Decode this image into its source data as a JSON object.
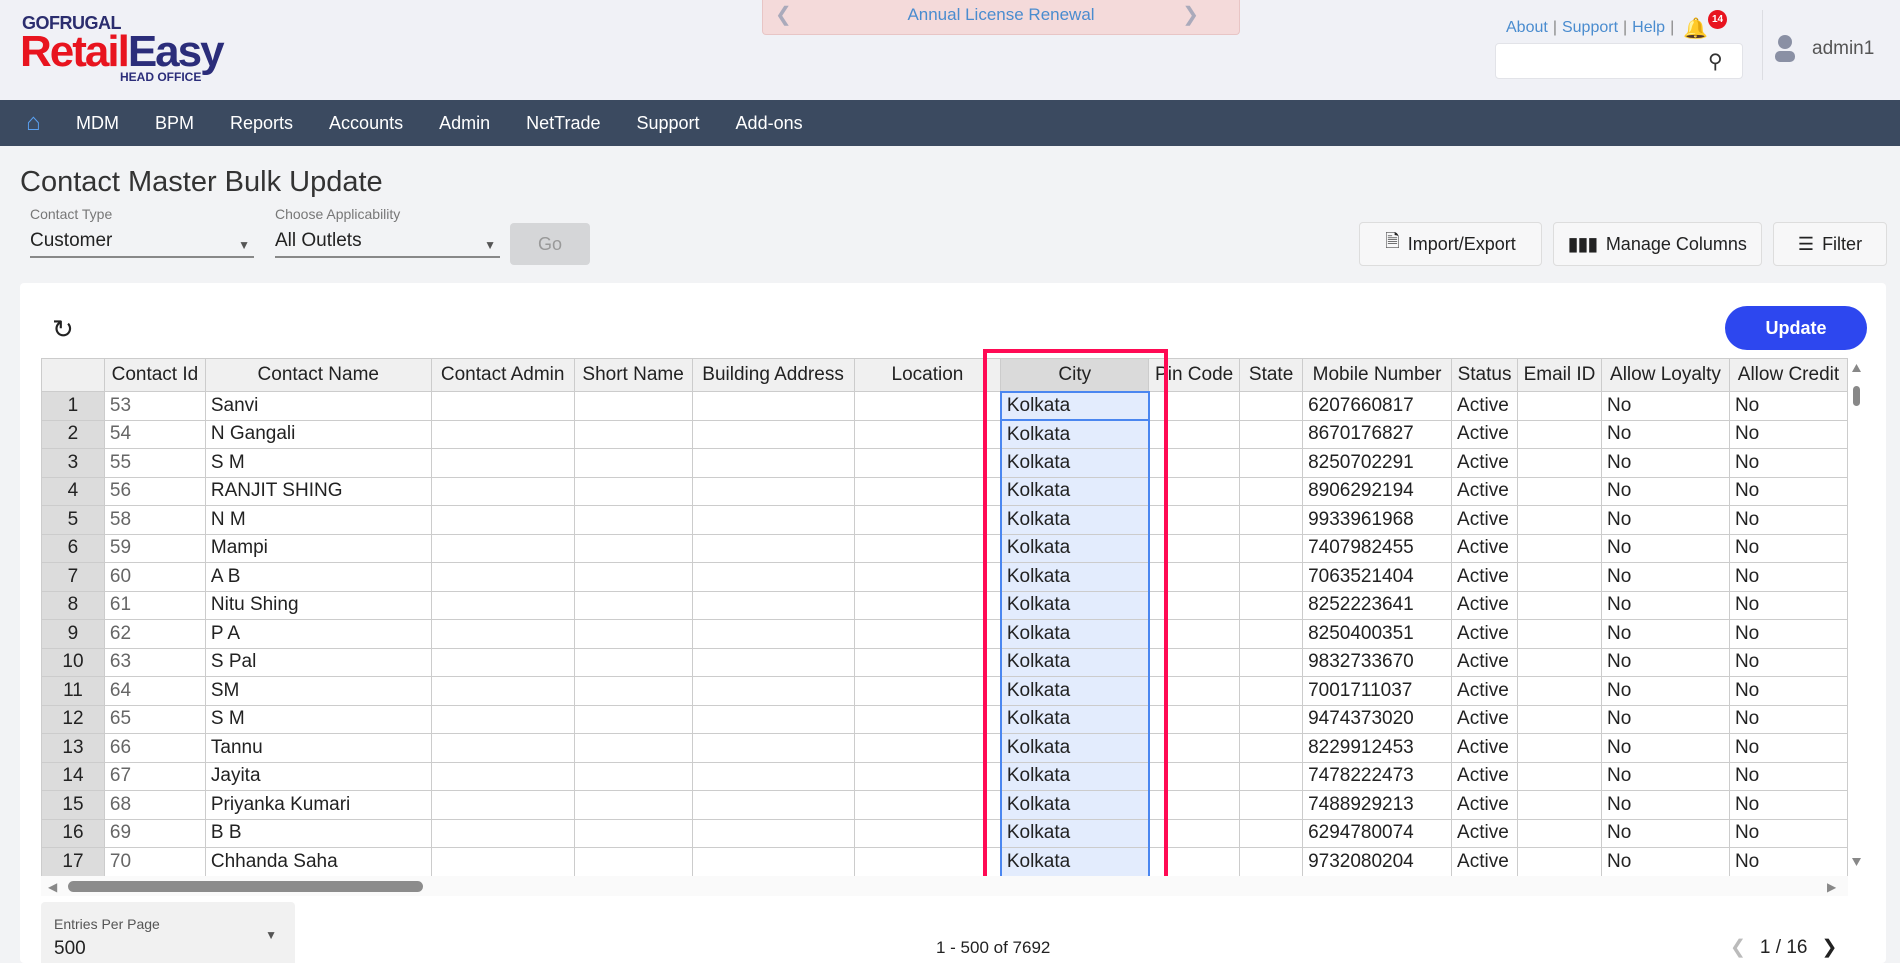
{
  "brand": {
    "top": "GOFRUGAL",
    "main_red": "Retail",
    "main_blue": "Easy",
    "sub": "HEAD OFFICE"
  },
  "banner": {
    "text": "Annual License Renewal"
  },
  "toplinks": {
    "about": "About",
    "support": "Support",
    "help": "Help",
    "notifications": "14"
  },
  "search": {
    "placeholder": "",
    "value": ""
  },
  "user": {
    "name": "admin1"
  },
  "nav": {
    "items": [
      "MDM",
      "BPM",
      "Reports",
      "Accounts",
      "Admin",
      "NetTrade",
      "Support",
      "Add-ons"
    ]
  },
  "page": {
    "title": "Contact Master Bulk Update"
  },
  "filters": {
    "contact_type_label": "Contact Type",
    "contact_type_value": "Customer",
    "applicability_label": "Choose Applicability",
    "applicability_value": "All Outlets",
    "go": "Go"
  },
  "toolbar": {
    "import_export": "Import/Export",
    "manage_columns": "Manage Columns",
    "filter": "Filter",
    "update": "Update"
  },
  "grid": {
    "columns": [
      "Contact Id",
      "Contact Name",
      "Contact Admin",
      "Short Name",
      "Building Address",
      "Location",
      "City",
      "Pin Code",
      "State",
      "Mobile Number",
      "Status",
      "Email ID",
      "Allow Loyalty",
      "Allow Credit"
    ],
    "selected_column": "City",
    "rows": [
      [
        "53",
        "Sanvi",
        "Kolkata",
        "6207660817"
      ],
      [
        "54",
        "N Gangali",
        "Kolkata",
        "8670176827"
      ],
      [
        "55",
        "S M",
        "Kolkata",
        "8250702291"
      ],
      [
        "56",
        "RANJIT SHING",
        "Kolkata",
        "8906292194"
      ],
      [
        "58",
        "N M",
        "Kolkata",
        "9933961968"
      ],
      [
        "59",
        "Mampi",
        "Kolkata",
        "7407982455"
      ],
      [
        "60",
        "A B",
        "Kolkata",
        "7063521404"
      ],
      [
        "61",
        "Nitu Shing",
        "Kolkata",
        "8252223641"
      ],
      [
        "62",
        "P A",
        "Kolkata",
        "8250400351"
      ],
      [
        "63",
        "S Pal",
        "Kolkata",
        "9832733670"
      ],
      [
        "64",
        "SM",
        "Kolkata",
        "7001711037"
      ],
      [
        "65",
        "S M",
        "Kolkata",
        "9474373020"
      ],
      [
        "66",
        "Tannu",
        "Kolkata",
        "8229912453"
      ],
      [
        "67",
        "Jayita",
        "Kolkata",
        "7478222473"
      ],
      [
        "68",
        "Priyanka Kumari",
        "Kolkata",
        "7488929213"
      ],
      [
        "69",
        "B B",
        "Kolkata",
        "6294780074"
      ],
      [
        "70",
        "Chhanda Saha",
        "Kolkata",
        "9732080204"
      ]
    ],
    "status": "Active",
    "allow_loyalty": "No",
    "allow_credit": "No"
  },
  "footer": {
    "entries_label": "Entries Per Page",
    "entries_value": "500",
    "range": "1 - 500 of 7692",
    "page": "1 / 16"
  },
  "colors": {
    "nav_bg": "#3b4a60",
    "accent": "#2d47ef",
    "highlight": "#ff0a54",
    "badge": "#e8141f"
  }
}
